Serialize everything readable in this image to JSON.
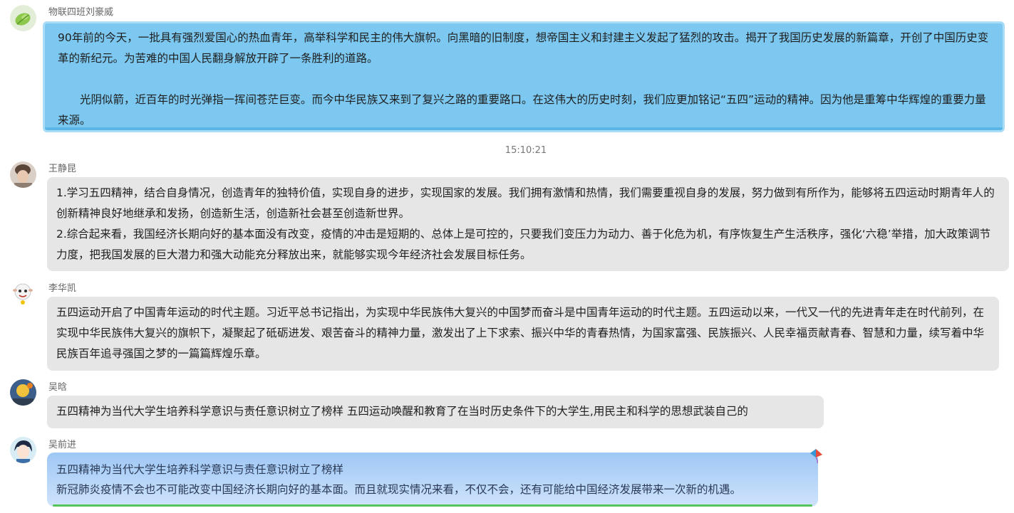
{
  "messages": [
    {
      "sender": "物联四班刘豪威",
      "avatar_icon": "green-leaf-avatar",
      "paragraphs": [
        "90年前的今天，一批具有强烈爱国心的热血青年，高举科学和民主的伟大旗帜。向黑暗的旧制度，想帝国主义和封建主义发起了猛烈的攻击。揭开了我国历史发展的新篇章，开创了中国历史变革的新纪元。为苦难的中国人民翻身解放开辟了一条胜利的道路。",
        "光阴似箭，近百年的时光弹指一挥间苍茫巨变。而今中华民族又来到了复兴之路的重要路口。在这伟大的历史时刻，我们应更加铭记“五四”运动的精神。因为他是重筹中华辉煌的重要力量来源。"
      ]
    },
    {
      "sender": "王静昆",
      "avatar_icon": "photo-avatar",
      "paragraphs": [
        "1.学习五四精神，结合自身情况，创造青年的独特价值，实现自身的进步，实现国家的发展。我们拥有激情和热情，我们需要重视自身的发展，努力做到有所作为，能够将五四运动时期青年人的创新精神良好地继承和发扬，创造新生活，创造新社会甚至创造新世界。",
        "2.综合起来看，我国经济长期向好的基本面没有改变，疫情的冲击是短期的、总体上是可控的，只要我们变压力为动力、善于化危为机，有序恢复生产生活秩序，强化‘六稳’举措，加大政策调节力度，把我国发展的巨大潜力和强大动能充分释放出来，就能够实现今年经济社会发展目标任务。"
      ]
    },
    {
      "sender": "李华凯",
      "avatar_icon": "cartoon-sheep-avatar",
      "paragraphs": [
        "五四运动开启了中国青年运动的时代主题。习近平总书记指出，为实现中华民族伟大复兴的中国梦而奋斗是中国青年运动的时代主题。五四运动以来，一代又一代的先进青年走在时代前列，在实现中华民族伟大复兴的旗帜下，凝聚起了砥砺进发、艰苦奋斗的精神力量，激发出了上下求索、振兴中华的青春热情，为国家富强、民族振兴、人民幸福贡献青春、智慧和力量，续写着中华民族百年追寻强国之梦的一篇篇辉煌乐章。"
      ]
    },
    {
      "sender": "吴晗",
      "avatar_icon": "photo-avatar",
      "paragraphs": [
        "五四精神为当代大学生培养科学意识与责任意识树立了榜样 五四运动唤醒和教育了在当时历史条件下的大学生,用民主和科学的思想武装自己的"
      ]
    },
    {
      "sender": "吴前进",
      "avatar_icon": "anime-avatar",
      "paragraphs": [
        "五四精神为当代大学生培养科学意识与责任意识树立了榜样",
        "新冠肺炎疫情不会也不可能改变中国经济长期向好的基本面。而且就现实情况来看，不仅不会，还有可能给中国经济发展带来一次新的机遇。"
      ]
    }
  ],
  "timestamp": "15:10:21",
  "colors": {
    "bubble_default": "#e6e6e6",
    "bubble_sky": "#7cc8f0",
    "bubble_gradient_top": "#9ec7f5",
    "accent_green": "#55c25a"
  }
}
